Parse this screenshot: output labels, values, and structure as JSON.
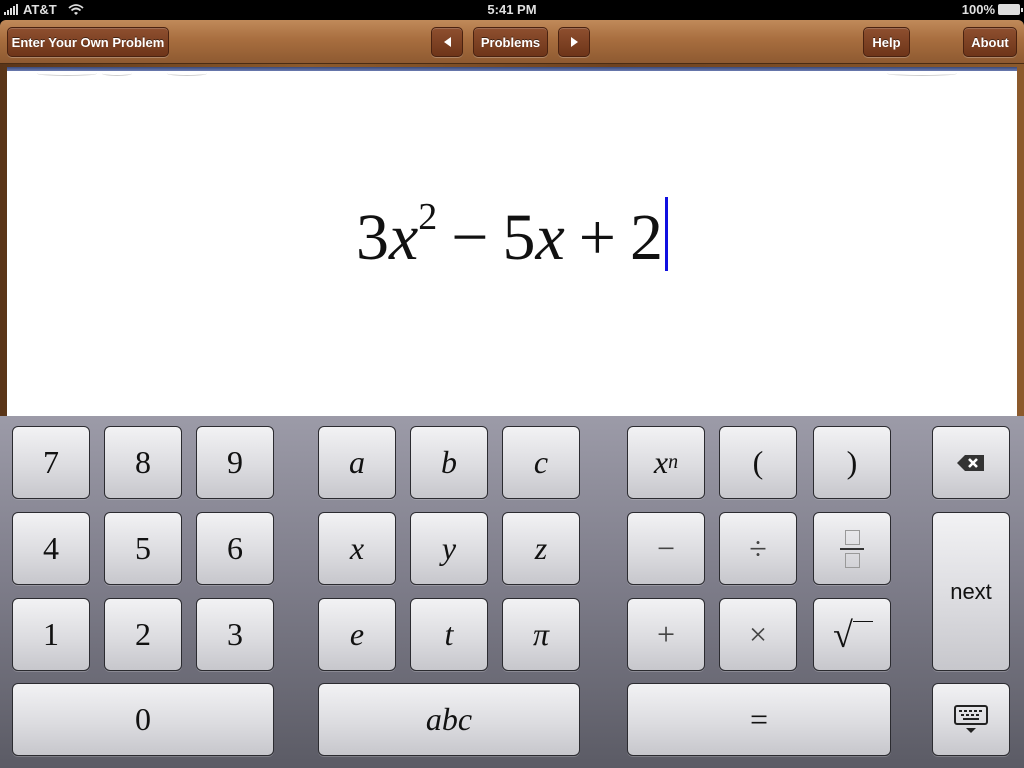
{
  "status_bar": {
    "carrier": "AT&T",
    "time": "5:41 PM",
    "battery": "100%"
  },
  "toolbar": {
    "enter_problem_label": "Enter Your Own Problem",
    "prev_icon": "triangle-left-icon",
    "problems_label": "Problems",
    "next_icon": "triangle-right-icon",
    "help_label": "Help",
    "about_label": "About"
  },
  "editor": {
    "expression_text": "3x^2 − 5x + 2",
    "parts": {
      "coef1": "3",
      "var1": "x",
      "exp1": "2",
      "op1": "−",
      "coef2": "5",
      "var2": "x",
      "op2": "+",
      "const": "2"
    },
    "caret_color": "#1010e0"
  },
  "keypad": {
    "digits": {
      "k7": "7",
      "k8": "8",
      "k9": "9",
      "k4": "4",
      "k5": "5",
      "k6": "6",
      "k1": "1",
      "k2": "2",
      "k3": "3",
      "k0": "0"
    },
    "letters": {
      "a": "a",
      "b": "b",
      "c": "c",
      "x": "x",
      "y": "y",
      "z": "z",
      "e": "e",
      "t": "t",
      "pi": "π",
      "abc": "abc"
    },
    "operators": {
      "power_base": "x",
      "power_exp": "n",
      "lparen": "(",
      "rparen": ")",
      "minus": "−",
      "divide": "÷",
      "plus": "+",
      "times": "×",
      "sqrt": "√",
      "equals": "="
    },
    "fraction_icon": "fraction-icon",
    "backspace_icon": "backspace-icon",
    "next_label": "next",
    "hide_keyboard_icon": "keyboard-hide-icon"
  }
}
